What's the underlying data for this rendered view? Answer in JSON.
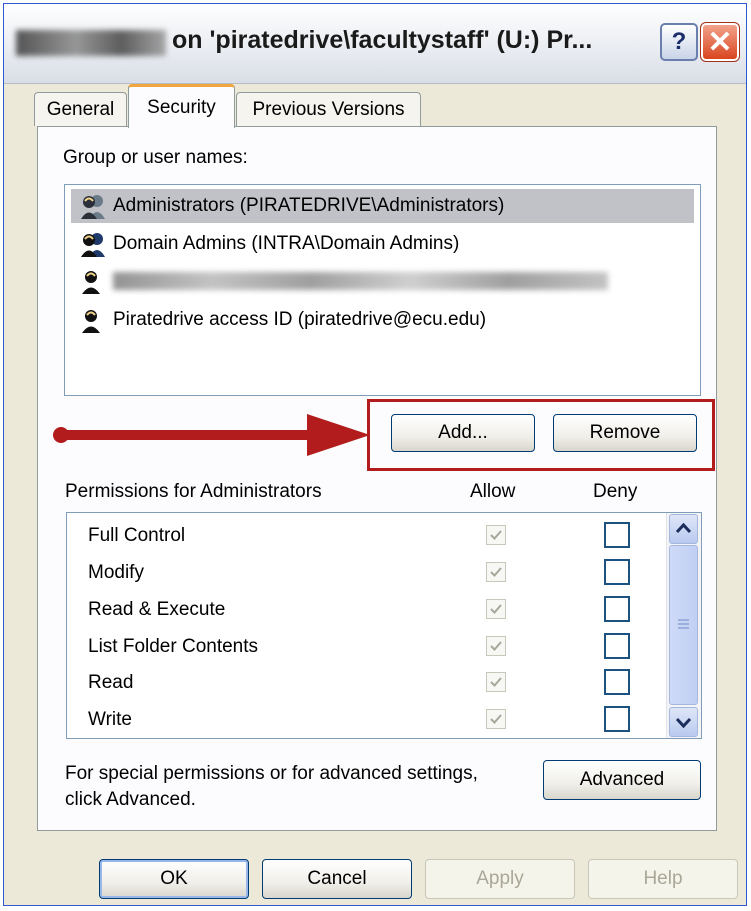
{
  "window": {
    "title_suffix": "on 'piratedrive\\facultystaff' (U:) Pr...",
    "help_glyph": "?",
    "close_glyph": "✕"
  },
  "tabs": [
    {
      "label": "General",
      "active": false
    },
    {
      "label": "Security",
      "active": true
    },
    {
      "label": "Previous Versions",
      "active": false
    }
  ],
  "groups": {
    "heading": "Group or user names:",
    "items": [
      {
        "label": "Administrators (PIRATEDRIVE\\Administrators)",
        "icon": "group-icon",
        "selected": true
      },
      {
        "label": "Domain Admins (INTRA\\Domain Admins)",
        "icon": "group-icon",
        "selected": false
      },
      {
        "label": "",
        "icon": "user-icon",
        "selected": false,
        "redacted": true
      },
      {
        "label": "Piratedrive access ID (piratedrive@ecu.edu)",
        "icon": "user-icon",
        "selected": false
      }
    ],
    "add_label": "Add...",
    "remove_label": "Remove"
  },
  "permissions": {
    "heading": "Permissions for Administrators",
    "allow_label": "Allow",
    "deny_label": "Deny",
    "rows": [
      {
        "label": "Full Control",
        "allow": true,
        "deny": false
      },
      {
        "label": "Modify",
        "allow": true,
        "deny": false
      },
      {
        "label": "Read & Execute",
        "allow": true,
        "deny": false
      },
      {
        "label": "List Folder Contents",
        "allow": true,
        "deny": false
      },
      {
        "label": "Read",
        "allow": true,
        "deny": false
      },
      {
        "label": "Write",
        "allow": true,
        "deny": false
      }
    ]
  },
  "advanced": {
    "text_line1": "For special permissions or for advanced settings,",
    "text_line2": "click Advanced.",
    "button_label": "Advanced"
  },
  "footer": {
    "ok_label": "OK",
    "cancel_label": "Cancel",
    "apply_label": "Apply",
    "help_label": "Help"
  },
  "colors": {
    "annotation_red": "#b21c1c",
    "selection_gray": "#c1c2c8",
    "tab_accent": "#f0a53e"
  }
}
